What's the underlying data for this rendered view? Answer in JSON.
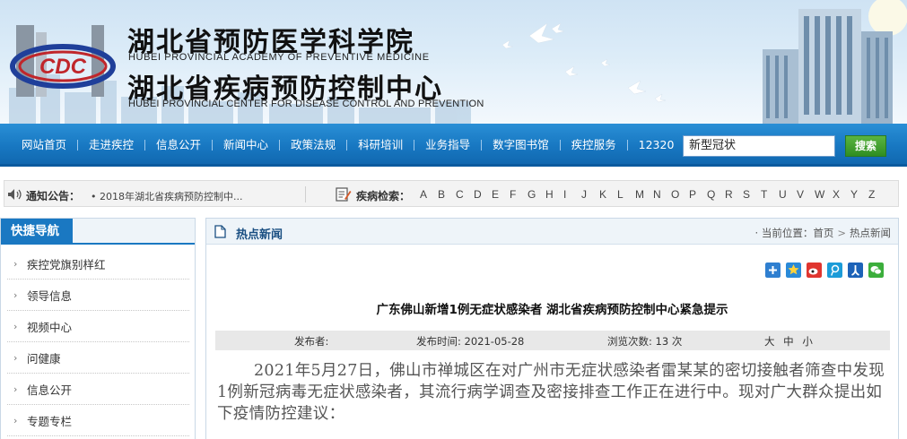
{
  "header": {
    "org_cn_1": "湖北省预防医学科学院",
    "org_en_1": "HUBEI PROVINCIAL ACADEMY OF PREVENTIVE MEDICINE",
    "org_cn_2": "湖北省疾病预防控制中心",
    "org_en_2": "HUBEI PROVINCIAL CENTER FOR DISEASE CONTROL AND PREVENTION",
    "logo_text": "CDC"
  },
  "nav": {
    "items": [
      "网站首页",
      "走进疾控",
      "信息公开",
      "新闻中心",
      "政策法规",
      "科研培训",
      "业务指导",
      "数字图书馆",
      "疾控服务",
      "12320"
    ],
    "search_value": "新型冠状",
    "search_button": "搜索"
  },
  "notice": {
    "label": "通知公告：",
    "text": "• 2018年湖北省疾病预防控制中..."
  },
  "disease_search": {
    "label": "疾病检索：",
    "letters": [
      "A",
      "B",
      "C",
      "D",
      "E",
      "F",
      "G",
      "H",
      "I",
      "J",
      "K",
      "L",
      "M",
      "N",
      "O",
      "P",
      "Q",
      "R",
      "S",
      "T",
      "U",
      "V",
      "W",
      "X",
      "Y",
      "Z"
    ]
  },
  "sidebar": {
    "title": "快捷导航",
    "items": [
      "疾控党旗别样红",
      "领导信息",
      "视频中心",
      "问健康",
      "信息公开",
      "专题专栏"
    ]
  },
  "main": {
    "section_title": "热点新闻",
    "breadcrumb": {
      "prefix": "· 当前位置：",
      "home": "首页",
      "current": "热点新闻"
    },
    "share_icons": [
      "plus-share-icon",
      "qzone-star-icon",
      "weibo-icon",
      "tencent-weibo-icon",
      "renren-icon",
      "wechat-icon"
    ],
    "article": {
      "title": "广东佛山新增1例无症状感染者 湖北省疾病预防控制中心紧急提示",
      "publisher_label": "发布者:",
      "publish_time": "发布时间: 2021-05-28",
      "views": "浏览次数: 13 次",
      "font_size_large": "大",
      "font_size_medium": "中",
      "font_size_small": "小",
      "body": "2021年5月27日，佛山市禅城区在对广州市无症状感染者雷某某的密切接触者筛查中发现1例新冠病毒无症状感染者，其流行病学调查及密接排查工作正在进行中。现对广大群众提出如下疫情防控建议："
    }
  },
  "colors": {
    "nav_blue": "#1878c2",
    "search_green": "#3a9a2c",
    "title_blue": "#1a4f82"
  }
}
